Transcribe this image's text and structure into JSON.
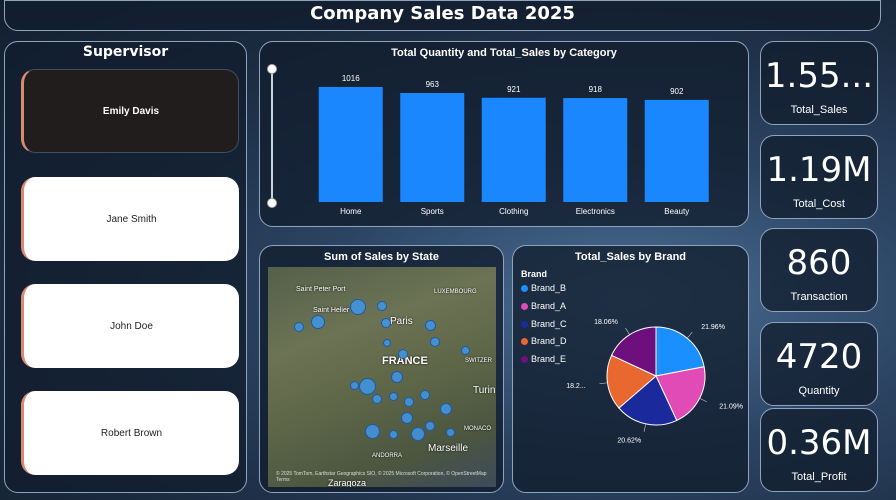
{
  "title": "Company Sales Data 2025",
  "supervisor": {
    "title": "Supervisor",
    "items": [
      {
        "label": "Emily Davis",
        "selected": true
      },
      {
        "label": "Jane Smith",
        "selected": false
      },
      {
        "label": "John Doe",
        "selected": false
      },
      {
        "label": "Robert Brown",
        "selected": false
      }
    ]
  },
  "bar_chart": {
    "title": "Total Quantity and Total_Sales by Category"
  },
  "map": {
    "title": "Sum of Sales by State",
    "labels": {
      "saint_peter_port": "Saint Peter Port",
      "saint_helier": "Saint Helier",
      "paris": "Paris",
      "luxembourg": "LUXEMBOURG",
      "france": "FRANCE",
      "switzerland": "SWITZER",
      "turin": "Turin",
      "monaco": "MONACO",
      "andorra": "ANDORRA",
      "marseille": "Marseille",
      "zaragoza": "Zaragoza"
    },
    "credit": "© 2025 TomTom, Earthstar Geographics SIO, © 2025 Microsoft Corporation, © OpenStreetMap  Terms"
  },
  "pie": {
    "title": "Total_Sales by Brand",
    "legend_title": "Brand"
  },
  "kpis": [
    {
      "value": "1.55...",
      "label": "Total_Sales"
    },
    {
      "value": "1.19M",
      "label": "Total_Cost"
    },
    {
      "value": "860",
      "label": "Transaction"
    },
    {
      "value": "4720",
      "label": "Quantity"
    },
    {
      "value": "0.36M",
      "label": "Total_Profit"
    }
  ],
  "colors": {
    "bar": "#1a87ff",
    "brand_b": "#1a8fff",
    "brand_a": "#e04bb5",
    "brand_c": "#1a2a9c",
    "brand_d": "#e8682f",
    "brand_e": "#6d0f7d",
    "supervisor_accent": "#d98a73"
  },
  "chart_data": [
    {
      "type": "bar",
      "title": "Total Quantity and Total_Sales by Category",
      "categories": [
        "Home",
        "Sports",
        "Clothing",
        "Electronics",
        "Beauty"
      ],
      "values": [
        1016,
        963,
        921,
        918,
        902
      ],
      "data_labels": [
        "1016",
        "963",
        "921",
        "918",
        "902"
      ],
      "ylim": [
        0,
        1016
      ]
    },
    {
      "type": "pie",
      "title": "Total_Sales by Brand",
      "legend_title": "Brand",
      "legend": [
        "Brand_B",
        "Brand_A",
        "Brand_C",
        "Brand_D",
        "Brand_E"
      ],
      "slices": [
        {
          "name": "Brand_B",
          "value": 21.96,
          "label": "21.96%"
        },
        {
          "name": "Brand_A",
          "value": 21.09,
          "label": "21.09%"
        },
        {
          "name": "Brand_C",
          "value": 20.62,
          "label": "20.62%"
        },
        {
          "name": "Brand_D",
          "value": 18.27,
          "label": "18.2..."
        },
        {
          "name": "Brand_E",
          "value": 18.06,
          "label": "18.06%"
        }
      ]
    }
  ]
}
